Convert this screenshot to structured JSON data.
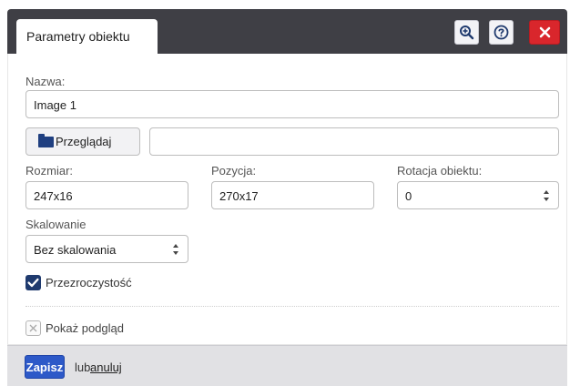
{
  "dialog": {
    "tab_title": "Parametry obiektu",
    "buttons": {
      "zoom_icon": "zoom-in-icon",
      "help_icon": "help-icon",
      "close_icon": "close-icon"
    }
  },
  "form": {
    "name_label": "Nazwa:",
    "name_value": "Image 1",
    "browse_label": "Przeglądaj",
    "file_path_value": "",
    "size_label": "Rozmiar:",
    "size_value": "247x16",
    "position_label": "Pozycja:",
    "position_value": "270x17",
    "rotation_label": "Rotacja obiektu:",
    "rotation_value": "0",
    "scaling_label": "Skalowanie",
    "scaling_value": "Bez skalowania",
    "transparency_label": "Przezroczystość",
    "transparency_checked": true,
    "preview_label": "Pokaż podgląd",
    "preview_checked": false
  },
  "footer": {
    "save_label": "Zapisz",
    "or_label": "lub",
    "cancel_label": "anuluj"
  },
  "colors": {
    "titlebar": "#3f3f45",
    "close_button": "#d9262c",
    "save_button": "#2d59c8",
    "checkbox_checked": "#1f3a6e",
    "footer": "#e1e1e4"
  }
}
